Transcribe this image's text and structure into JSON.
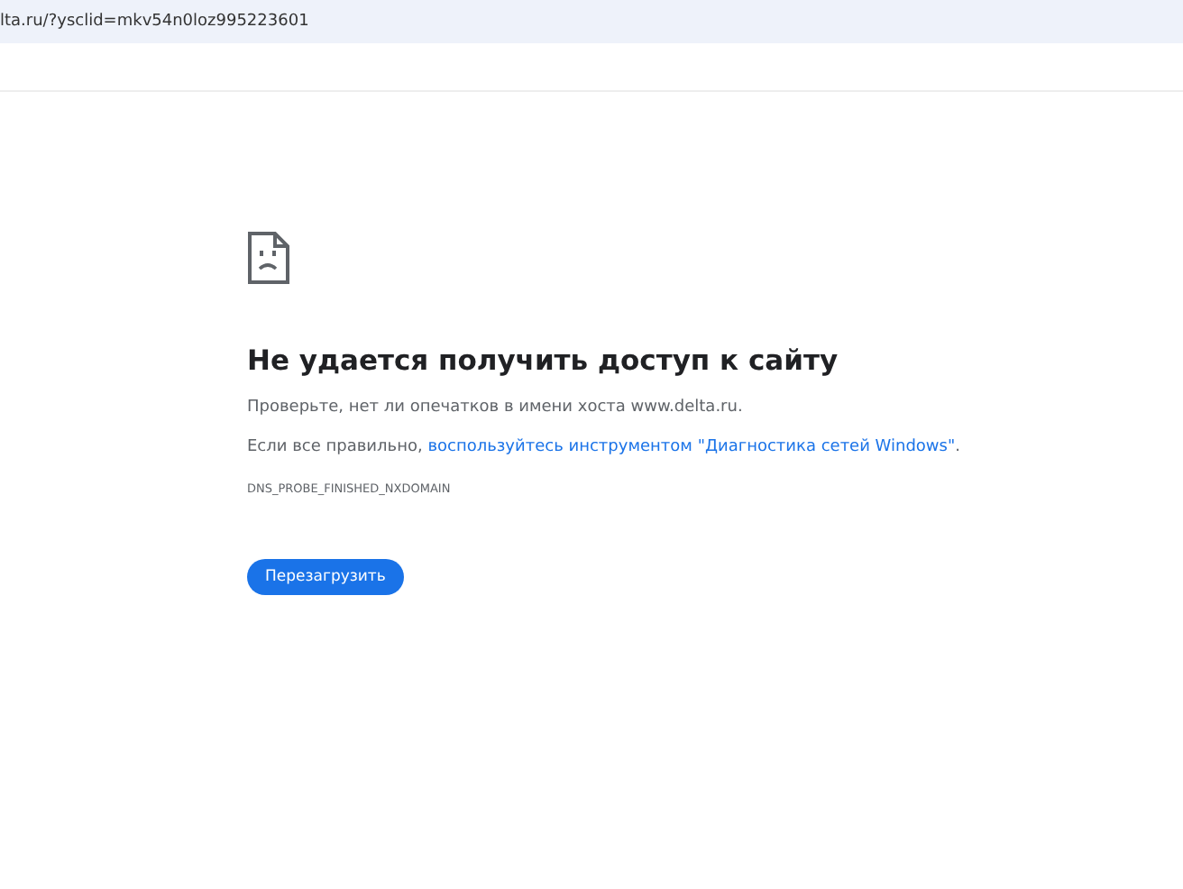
{
  "address_bar": {
    "url": "lta.ru/?ysclid=mkv54n0loz995223601"
  },
  "error": {
    "title": "Не удается получить доступ к сайту",
    "hint": "Проверьте, нет ли опечатков в имени хоста www.delta.ru.",
    "advice": {
      "prefix": "Если все правильно, ",
      "link": "воспользуйтесь инструментом \"Диагностика сетей Windows\"",
      "suffix": "."
    },
    "code": "DNS_PROBE_FINISHED_NXDOMAIN",
    "button": "Перезагрузить"
  }
}
